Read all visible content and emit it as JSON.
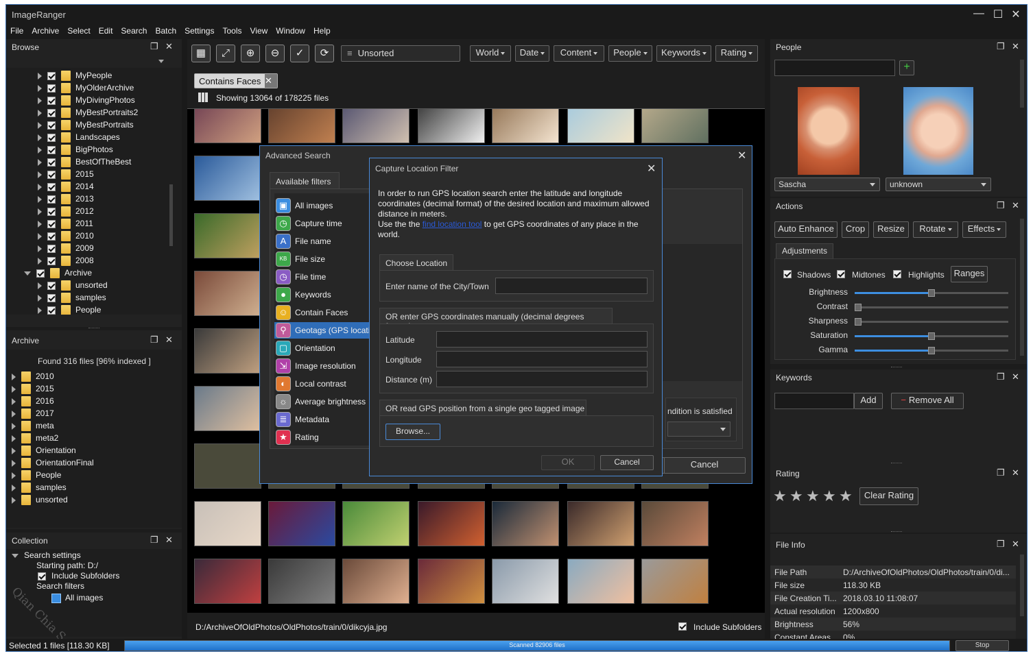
{
  "app": {
    "title": "ImageRanger"
  },
  "menu": [
    "File",
    "Archive",
    "Select",
    "Edit",
    "Search",
    "Batch",
    "Settings",
    "Tools",
    "View",
    "Window",
    "Help"
  ],
  "browse": {
    "title": "Browse",
    "items": [
      {
        "label": "MyPeople",
        "checked": true
      },
      {
        "label": "MyOlderArchive",
        "checked": true
      },
      {
        "label": "MyDivingPhotos",
        "checked": true
      },
      {
        "label": "MyBestPortraits2",
        "checked": true
      },
      {
        "label": "MyBestPortraits",
        "checked": true
      },
      {
        "label": "Landscapes",
        "checked": true
      },
      {
        "label": "BigPhotos",
        "checked": true
      },
      {
        "label": "BestOfTheBest",
        "checked": true
      },
      {
        "label": "2015",
        "checked": true
      },
      {
        "label": "2014",
        "checked": true
      },
      {
        "label": "2013",
        "checked": true
      },
      {
        "label": "2012",
        "checked": true
      },
      {
        "label": "2011",
        "checked": true
      },
      {
        "label": "2010",
        "checked": true
      },
      {
        "label": "2009",
        "checked": true
      },
      {
        "label": "2008",
        "checked": true
      },
      {
        "label": "Archive",
        "checked": true,
        "open": true
      },
      {
        "label": "unsorted",
        "checked": true
      },
      {
        "label": "samples",
        "checked": true
      },
      {
        "label": "People",
        "checked": true
      }
    ]
  },
  "archive": {
    "title": "Archive",
    "found": "Found 316 files [96% indexed ]",
    "items": [
      "2010",
      "2015",
      "2016",
      "2017",
      "meta",
      "meta2",
      "Orientation",
      "OrientationFinal",
      "People",
      "samples",
      "unsorted"
    ]
  },
  "collection": {
    "title": "Collection",
    "search_settings": "Search settings",
    "starting_path": "Starting path: D:/",
    "include_subfolders": "Include Subfolders",
    "search_filters": "Search filters",
    "all_images": "All images"
  },
  "status": {
    "selected": "Selected 1 files [118.30 KB]",
    "scanned": "Scanned 82906 files",
    "scan_progress": 1.0,
    "stop": "Stop"
  },
  "toolbar": {
    "unsorted": "Unsorted",
    "filters": [
      "World",
      "Date",
      "Content",
      "People",
      "Keywords",
      "Rating"
    ],
    "tag": "Contains Faces",
    "showing": "Showing 13064 of 178225 files"
  },
  "footer": {
    "path": "D:/ArchiveOfOldPhotos/OldPhotos/train/0/dikcyja.jpg",
    "include_subfolders": "Include Subfolders"
  },
  "advanced_search": {
    "title": "Advanced Search",
    "available_filters": "Available filters",
    "filters": [
      {
        "label": "All images",
        "icon": "gallery-icon",
        "color": "#3a8de0"
      },
      {
        "label": "Capture time",
        "icon": "clock-icon",
        "color": "#3da84a"
      },
      {
        "label": "File name",
        "icon": "letter-a-icon",
        "color": "#3a70c8"
      },
      {
        "label": "File size",
        "icon": "kb-icon",
        "color": "#3da84a"
      },
      {
        "label": "File time",
        "icon": "clock-icon",
        "color": "#8a5cc4"
      },
      {
        "label": "Keywords",
        "icon": "speech-bubble-icon",
        "color": "#3da84a"
      },
      {
        "label": "Contain Faces",
        "icon": "smiley-icon",
        "color": "#e8b020"
      },
      {
        "label": "Geotags (GPS locati",
        "icon": "map-pin-icon",
        "color": "#c05a9a",
        "selected": true
      },
      {
        "label": "Orientation",
        "icon": "rotate-icon",
        "color": "#2aa8b8"
      },
      {
        "label": "Image resolution",
        "icon": "resize-icon",
        "color": "#b040a8"
      },
      {
        "label": "Local contrast",
        "icon": "contrast-icon",
        "color": "#e07830"
      },
      {
        "label": "Average brightness",
        "icon": "sun-icon",
        "color": "#888888"
      },
      {
        "label": "Metadata",
        "icon": "list-icon",
        "color": "#6a6ad0"
      },
      {
        "label": "Rating",
        "icon": "star-icon",
        "color": "#e03050"
      }
    ],
    "condition": "ndition is satisfied",
    "cancel": "Cancel"
  },
  "capture_location": {
    "title": "Capture Location Filter",
    "desc1": "In order to run GPS location search enter the latitude and longitude coordinates (decimal format) of the desired location and maximum allowed distance in meters.",
    "desc2_pre": "Use the the",
    "desc2_link": "find location tool",
    "desc2_post": "to get GPS coordinates of any place in the world.",
    "choose_location": "Choose Location",
    "city_label": "Enter name of the City/Town",
    "gps_manual": "OR enter GPS coordinates manually (decimal degrees format)",
    "latitude": "Latitude",
    "longitude": "Longitude",
    "distance": "Distance (m)",
    "geo_image": "OR read GPS position from a single geo tagged image",
    "browse": "Browse...",
    "ok": "OK",
    "cancel": "Cancel"
  },
  "people": {
    "title": "People",
    "persons": [
      {
        "name": "Sascha"
      },
      {
        "name": "unknown"
      }
    ]
  },
  "actions": {
    "title": "Actions",
    "buttons": [
      "Auto Enhance",
      "Crop",
      "Resize",
      "Rotate",
      "Effects"
    ],
    "adjustments_tab": "Adjustments",
    "shadows": "Shadows",
    "midtones": "Midtones",
    "highlights": "Highlights",
    "ranges": "Ranges",
    "sliders": [
      {
        "label": "Brightness",
        "value": 0.5
      },
      {
        "label": "Contrast",
        "value": 0.0
      },
      {
        "label": "Sharpness",
        "value": 0.0
      },
      {
        "label": "Saturation",
        "value": 0.5
      },
      {
        "label": "Gamma",
        "value": 0.5
      }
    ]
  },
  "keywords": {
    "title": "Keywords",
    "add": "Add",
    "remove_all": "Remove All"
  },
  "rating": {
    "title": "Rating",
    "stars": 5,
    "clear": "Clear Rating"
  },
  "file_info": {
    "title": "File Info",
    "rows": [
      {
        "k": "File Path",
        "v": "D:/ArchiveOfOldPhotos/OldPhotos/train/0/di..."
      },
      {
        "k": "File size",
        "v": "118.30 KB"
      },
      {
        "k": "File Creation Ti...",
        "v": "2018.03.10 11:08:07"
      },
      {
        "k": "Actual resolution",
        "v": "1200x800"
      },
      {
        "k": "Brightness",
        "v": "56%"
      },
      {
        "k": "Constant Areas",
        "v": "0%"
      }
    ]
  },
  "watermark": "Qian Chia Soft"
}
